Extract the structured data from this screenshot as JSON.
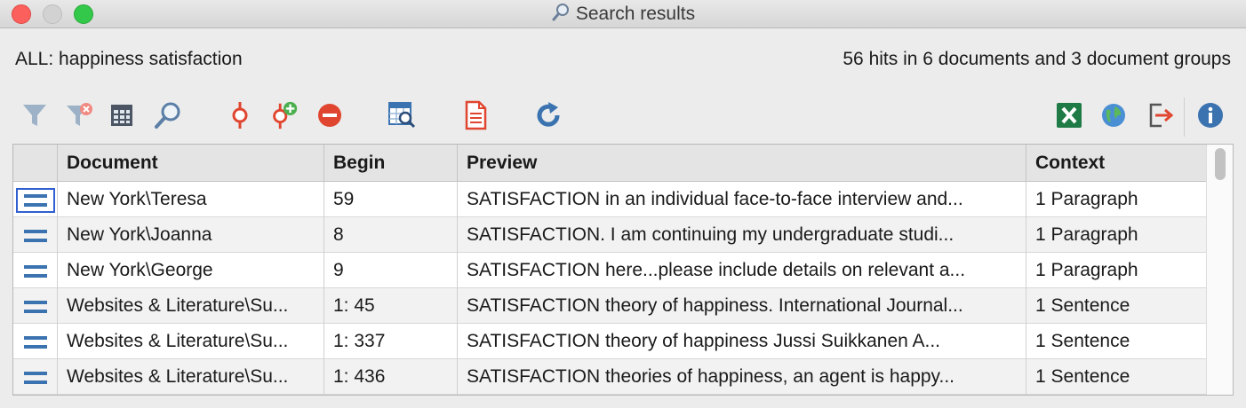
{
  "window": {
    "title": "Search results"
  },
  "summary": {
    "query": "ALL: happiness satisfaction",
    "hits": "56 hits in 6 documents and 3 document groups"
  },
  "toolbar": {
    "icons": [
      "filter-icon",
      "filter-remove-icon",
      "columns-icon",
      "search-icon",
      "hit-marker-icon",
      "add-hit-icon",
      "remove-icon",
      "table-search-icon",
      "document-icon",
      "refresh-icon",
      "excel-export-icon",
      "web-export-icon",
      "export-icon",
      "info-icon"
    ]
  },
  "table": {
    "headers": [
      "",
      "Document",
      "Begin",
      "Preview",
      "Context"
    ],
    "rows": [
      {
        "document": "New York\\Teresa",
        "begin": "59",
        "preview": "SATISFACTION in an individual face-to-face interview and...",
        "context": "1 Paragraph"
      },
      {
        "document": "New York\\Joanna",
        "begin": "8",
        "preview": "SATISFACTION.  I am continuing my undergraduate studi...",
        "context": "1 Paragraph"
      },
      {
        "document": "New York\\George",
        "begin": "9",
        "preview": "SATISFACTION here...please include details on relevant a...",
        "context": "1 Paragraph"
      },
      {
        "document": "Websites & Literature\\Su...",
        "begin": "1: 45",
        "preview": "SATISFACTION theory of happiness. International Journal...",
        "context": "1 Sentence"
      },
      {
        "document": "Websites & Literature\\Su...",
        "begin": "1: 337",
        "preview": "SATISFACTION theory of happiness   Jussi Suikkanen   A...",
        "context": "1 Sentence"
      },
      {
        "document": "Websites & Literature\\Su...",
        "begin": "1: 436",
        "preview": "SATISFACTION theories of happiness, an agent is   happy...",
        "context": "1 Sentence"
      }
    ]
  },
  "colors": {
    "accent": "#3b73b0",
    "red": "#e0452f",
    "green": "#1e7b45"
  }
}
